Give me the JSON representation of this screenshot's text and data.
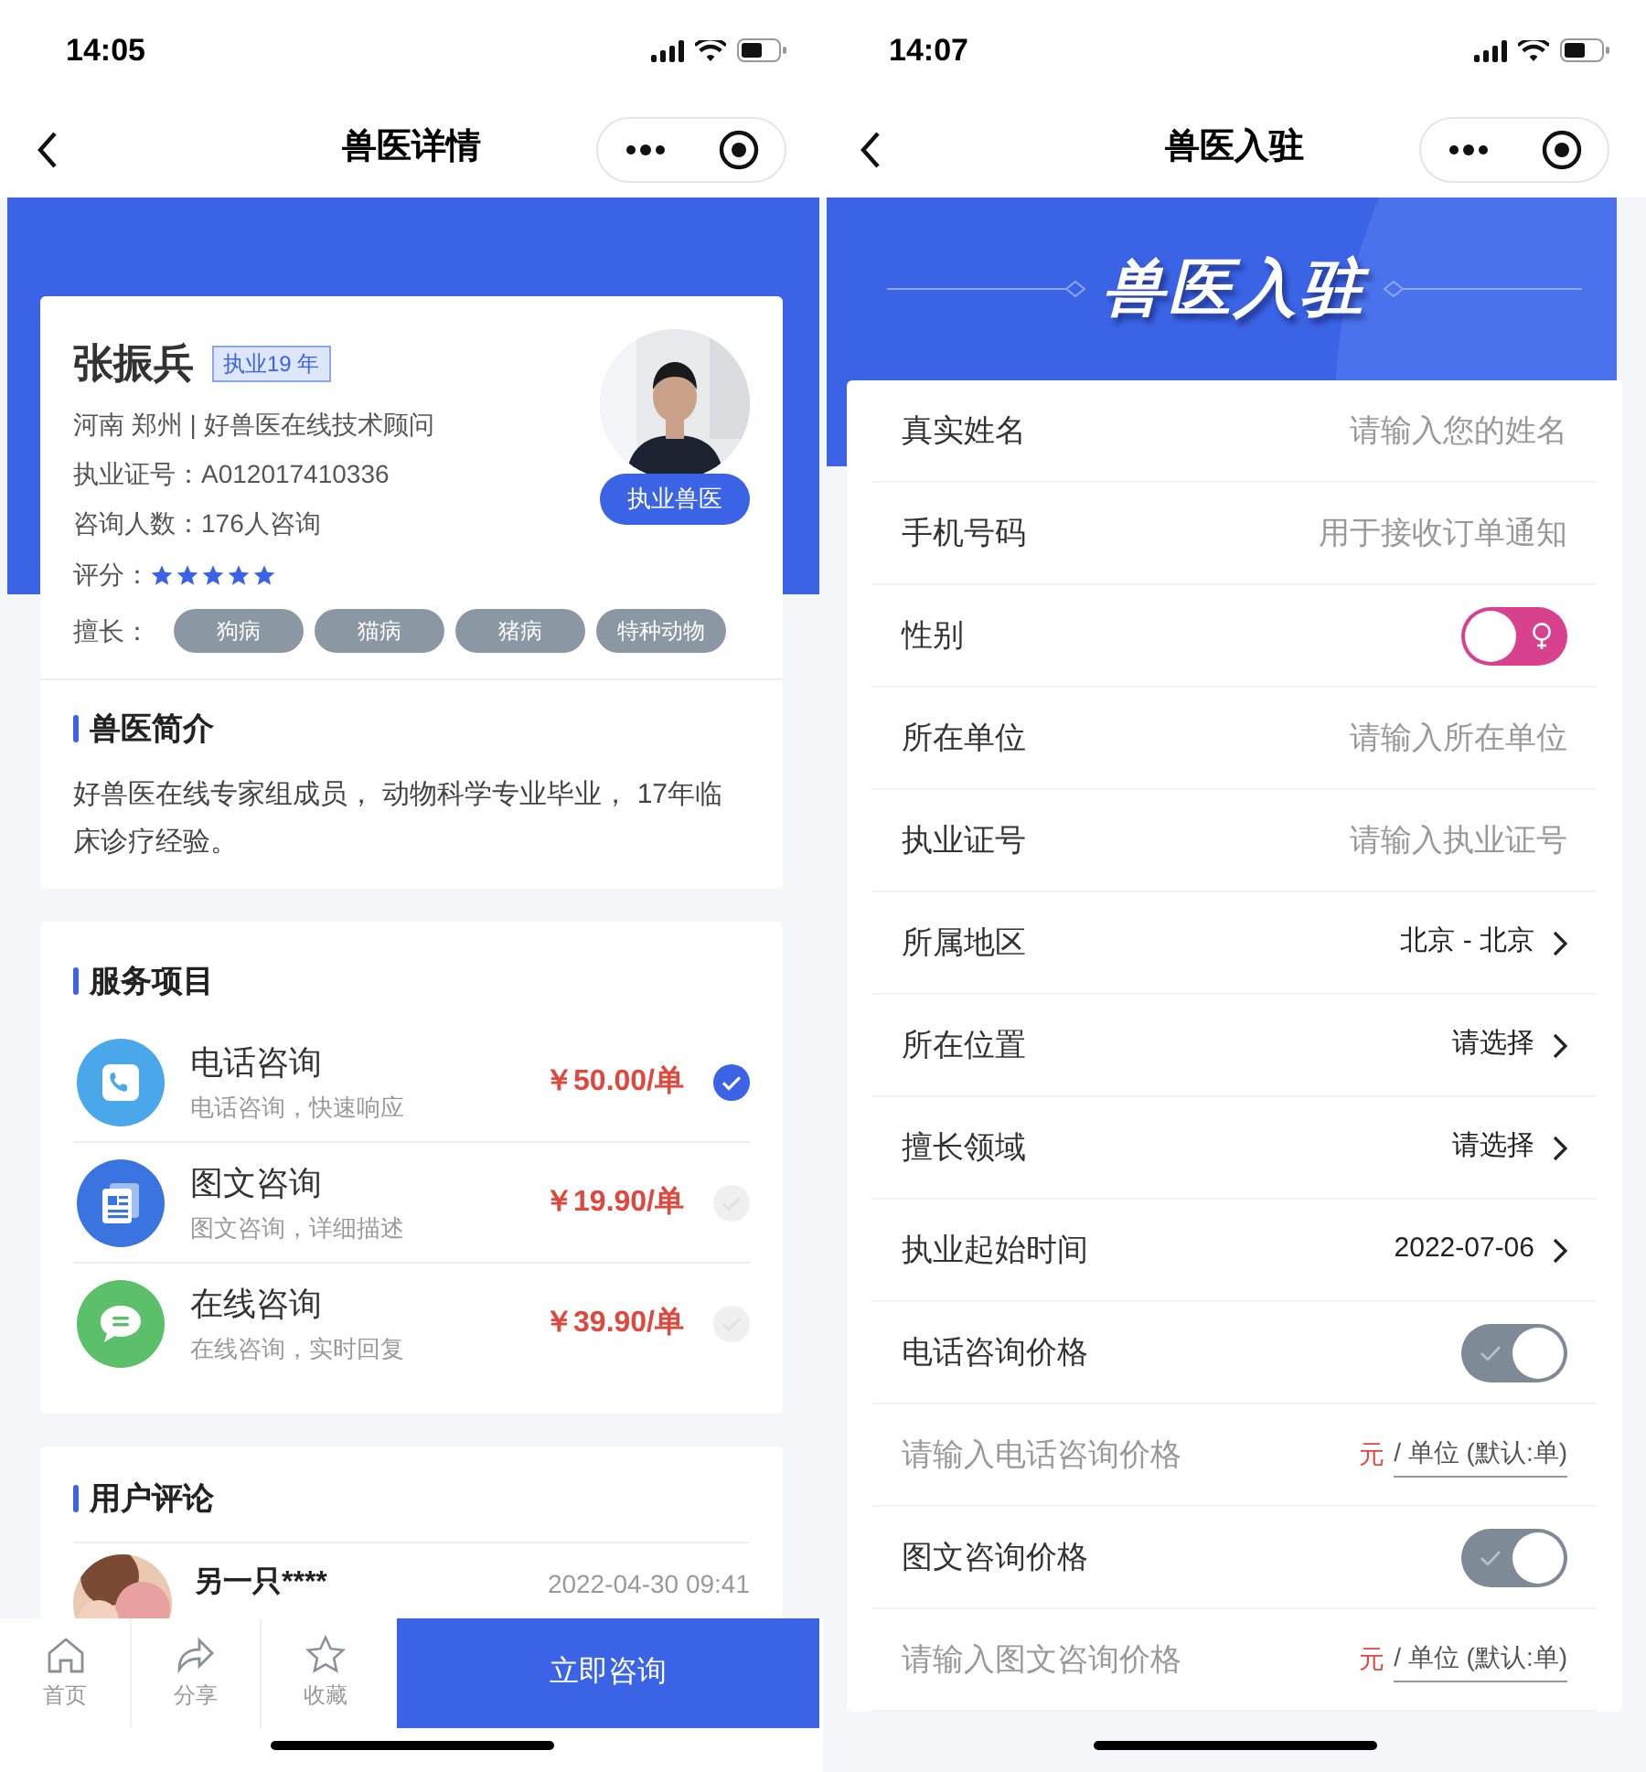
{
  "vet_detail": {
    "status_bar": {
      "time": "14:05"
    },
    "nav": {
      "title": "兽医详情"
    },
    "profile": {
      "name": "张振兵",
      "years_badge": "执业19 年",
      "role_badge": "执业兽医",
      "lines": [
        {
          "label": "河南 郑州 | 好兽医在线技术顾问"
        },
        {
          "label": "执业证号：A012017410336"
        },
        {
          "label": "咨询人数：176人咨询"
        }
      ],
      "rating_label": "评分：",
      "stars": 5,
      "specialty_label": "擅长：",
      "tags": [
        "狗病",
        "猫病",
        "猪病",
        "特种动物"
      ]
    },
    "intro": {
      "title": "兽医简介",
      "text": "好兽医在线专家组成员， 动物科学专业毕业， 17年临床诊疗经验。"
    },
    "services": {
      "title": "服务项目",
      "items": [
        {
          "kind": "phone",
          "title": "电话咨询",
          "subtitle": "电话咨询，快速响应",
          "price": "￥50.00/单",
          "selected": true
        },
        {
          "kind": "text",
          "title": "图文咨询",
          "subtitle": "图文咨询，详细描述",
          "price": "￥19.90/单",
          "selected": false
        },
        {
          "kind": "chat",
          "title": "在线咨询",
          "subtitle": "在线咨询，实时回复",
          "price": "￥39.90/单",
          "selected": false
        }
      ]
    },
    "comments": {
      "title": "用户评论",
      "items": [
        {
          "user": "另一只****",
          "time": "2022-04-30 09:41"
        }
      ]
    },
    "bottom_bar": {
      "items": [
        {
          "kind": "home",
          "label": "首页"
        },
        {
          "kind": "share",
          "label": "分享"
        },
        {
          "kind": "star",
          "label": "收藏"
        }
      ],
      "action": "立即咨询"
    }
  },
  "vet_signup": {
    "status_bar": {
      "time": "14:07"
    },
    "nav": {
      "title": "兽医入驻"
    },
    "banner": "兽医入驻",
    "fields": [
      {
        "kind": "input",
        "label": "真实姓名",
        "placeholder": "请输入您的姓名"
      },
      {
        "kind": "input",
        "label": "手机号码",
        "placeholder": "用于接收订单通知"
      },
      {
        "kind": "gender",
        "label": "性别",
        "female": true
      },
      {
        "kind": "input",
        "label": "所在单位",
        "placeholder": "请输入所在单位"
      },
      {
        "kind": "input",
        "label": "执业证号",
        "placeholder": "请输入执业证号"
      },
      {
        "kind": "select",
        "label": "所属地区",
        "value": "北京 - 北京"
      },
      {
        "kind": "select",
        "label": "所在位置",
        "value": "请选择"
      },
      {
        "kind": "select",
        "label": "擅长领域",
        "value": "请选择"
      },
      {
        "kind": "select",
        "label": "执业起始时间",
        "value": "2022-07-06"
      },
      {
        "kind": "toggle",
        "label": "电话咨询价格",
        "on": true
      },
      {
        "kind": "price",
        "placeholder": "请输入电话咨询价格",
        "currency": "元",
        "unit": "/ 单位 (默认:单)"
      },
      {
        "kind": "toggle",
        "label": "图文咨询价格",
        "on": true
      },
      {
        "kind": "price",
        "placeholder": "请输入图文咨询价格",
        "currency": "元",
        "unit": "/ 单位 (默认:单)"
      }
    ]
  }
}
